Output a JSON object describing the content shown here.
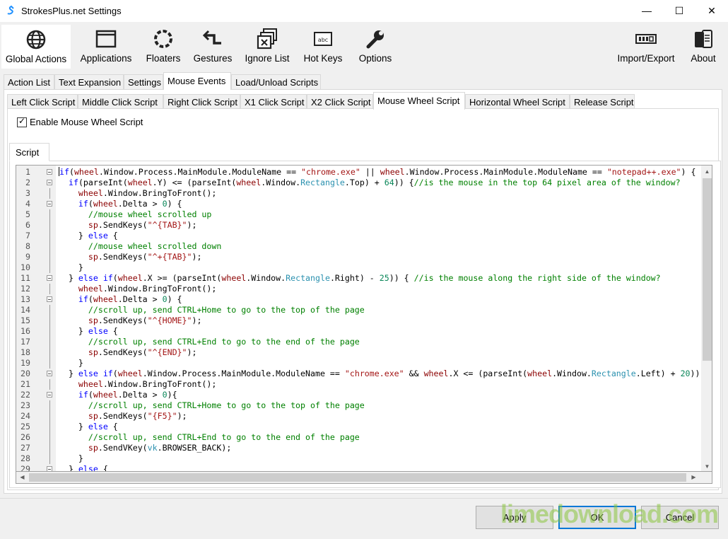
{
  "window": {
    "title": "StrokesPlus.net Settings",
    "minimize": "—",
    "maximize": "☐",
    "close": "✕"
  },
  "toolbar": [
    {
      "label": "Global Actions",
      "icon": "globe-icon"
    },
    {
      "label": "Applications",
      "icon": "window-icon"
    },
    {
      "label": "Floaters",
      "icon": "circle-dots-icon"
    },
    {
      "label": "Gestures",
      "icon": "gesture-arrow-icon"
    },
    {
      "label": "Ignore List",
      "icon": "ignore-windows-icon"
    },
    {
      "label": "Hot Keys",
      "icon": "keyboard-key-icon"
    },
    {
      "label": "Options",
      "icon": "wrench-icon"
    },
    {
      "label": "Import/Export",
      "icon": "import-export-icon"
    },
    {
      "label": "About",
      "icon": "about-icon"
    }
  ],
  "main_tabs": [
    "Action List",
    "Text Expansion",
    "Settings",
    "Mouse Events",
    "Load/Unload Scripts"
  ],
  "event_tabs": [
    "Left Click Script",
    "Middle Click Script",
    "Right Click Script",
    "X1 Click Script",
    "X2 Click Script",
    "Mouse Wheel Script",
    "Horizontal Wheel Script",
    "Release Script"
  ],
  "enable_checkbox": {
    "label": "Enable Mouse Wheel Script",
    "checked": true,
    "mark": "✓"
  },
  "script_tab": "Script",
  "code_line_numbers": [
    "1",
    "2",
    "3",
    "4",
    "5",
    "6",
    "7",
    "8",
    "9",
    "10",
    "11",
    "12",
    "13",
    "14",
    "15",
    "16",
    "17",
    "18",
    "19",
    "20",
    "21",
    "22",
    "23",
    "24",
    "25",
    "26",
    "27",
    "28",
    "29"
  ],
  "code_lines_plain": [
    "if(wheel.Window.Process.MainModule.ModuleName == \"chrome.exe\" || wheel.Window.Process.MainModule.ModuleName == \"notepad++.exe\") {",
    "  if(parseInt(wheel.Y) <= (parseInt(wheel.Window.Rectangle.Top) + 64)) {//is the mouse in the top 64 pixel area of the window?",
    "    wheel.Window.BringToFront();",
    "    if(wheel.Delta > 0) {",
    "      //mouse wheel scrolled up",
    "      sp.SendKeys(\"^{TAB}\");",
    "    } else {",
    "      //mouse wheel scrolled down",
    "      sp.SendKeys(\"^+{TAB}\");",
    "    }",
    "  } else if(wheel.X >= (parseInt(wheel.Window.Rectangle.Right) - 25)) { //is the mouse along the right side of the window?",
    "    wheel.Window.BringToFront();",
    "    if(wheel.Delta > 0) {",
    "      //scroll up, send CTRL+Home to go to the top of the page",
    "      sp.SendKeys(\"^{HOME}\");",
    "    } else {",
    "      //scroll up, send CTRL+End to go to the end of the page",
    "      sp.SendKeys(\"^{END}\");",
    "    }",
    "  } else if(wheel.Window.Process.MainModule.ModuleName == \"chrome.exe\" && wheel.X <= (parseInt(wheel.Window.Rectangle.Left) + 20)) {",
    "    wheel.Window.BringToFront();",
    "    if(wheel.Delta > 0){",
    "      //scroll up, send CTRL+Home to go to the top of the page",
    "      sp.SendKeys(\"{F5}\");",
    "    } else {",
    "      //scroll up, send CTRL+End to go to the end of the page",
    "      sp.SendVKey(vk.BROWSER_BACK);",
    "    }",
    "  } else {"
  ],
  "buttons": {
    "apply": "Apply",
    "ok": "OK",
    "cancel": "Cancel"
  },
  "watermark": "limedownload.com",
  "colors": {
    "keyword": "#0000ff",
    "variable": "#8b0000",
    "string": "#a31515",
    "comment": "#008000",
    "number": "#098658",
    "type": "#2b91af",
    "accent": "#0078d7"
  }
}
